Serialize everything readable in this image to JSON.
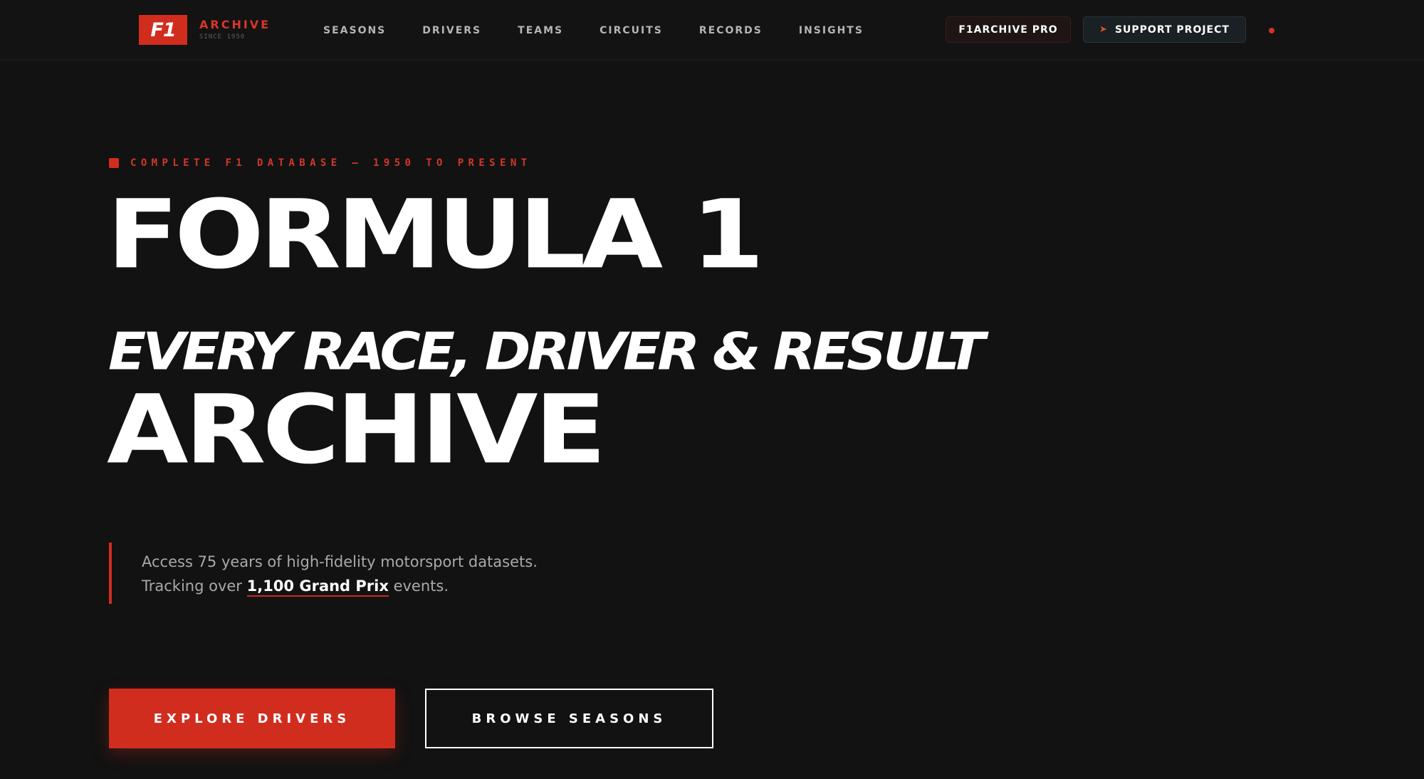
{
  "header": {
    "logo_mark": "F1",
    "logo_title": "ARCHIVE",
    "logo_subtitle": "SINCE 1950",
    "nav": [
      "SEASONS",
      "DRIVERS",
      "TEAMS",
      "CIRCUITS",
      "RECORDS",
      "INSIGHTS"
    ],
    "pro_label": "F1ARCHIVE PRO",
    "support_label": "SUPPORT PROJECT",
    "support_icon": "rocket-icon"
  },
  "hero": {
    "eyebrow": "COMPLETE F1 DATABASE — 1950 TO PRESENT",
    "title": "FORMULA 1",
    "subtitle": "EVERY RACE, DRIVER & RESULT",
    "title_2": "ARCHIVE",
    "desc_line1": "Access 75 years of high-fidelity motorsport datasets.",
    "desc_line2_prefix": "Tracking over ",
    "desc_line2_strong": "1,100 Grand Prix",
    "desc_line2_suffix": " events."
  },
  "actions": {
    "primary_label": "EXPLORE DRIVERS",
    "secondary_label": "BROWSE SEASONS"
  },
  "colors": {
    "background": "#121212",
    "accent": "#d12d1f",
    "text": "#ffffff",
    "muted_text": "#a9a9a9"
  }
}
